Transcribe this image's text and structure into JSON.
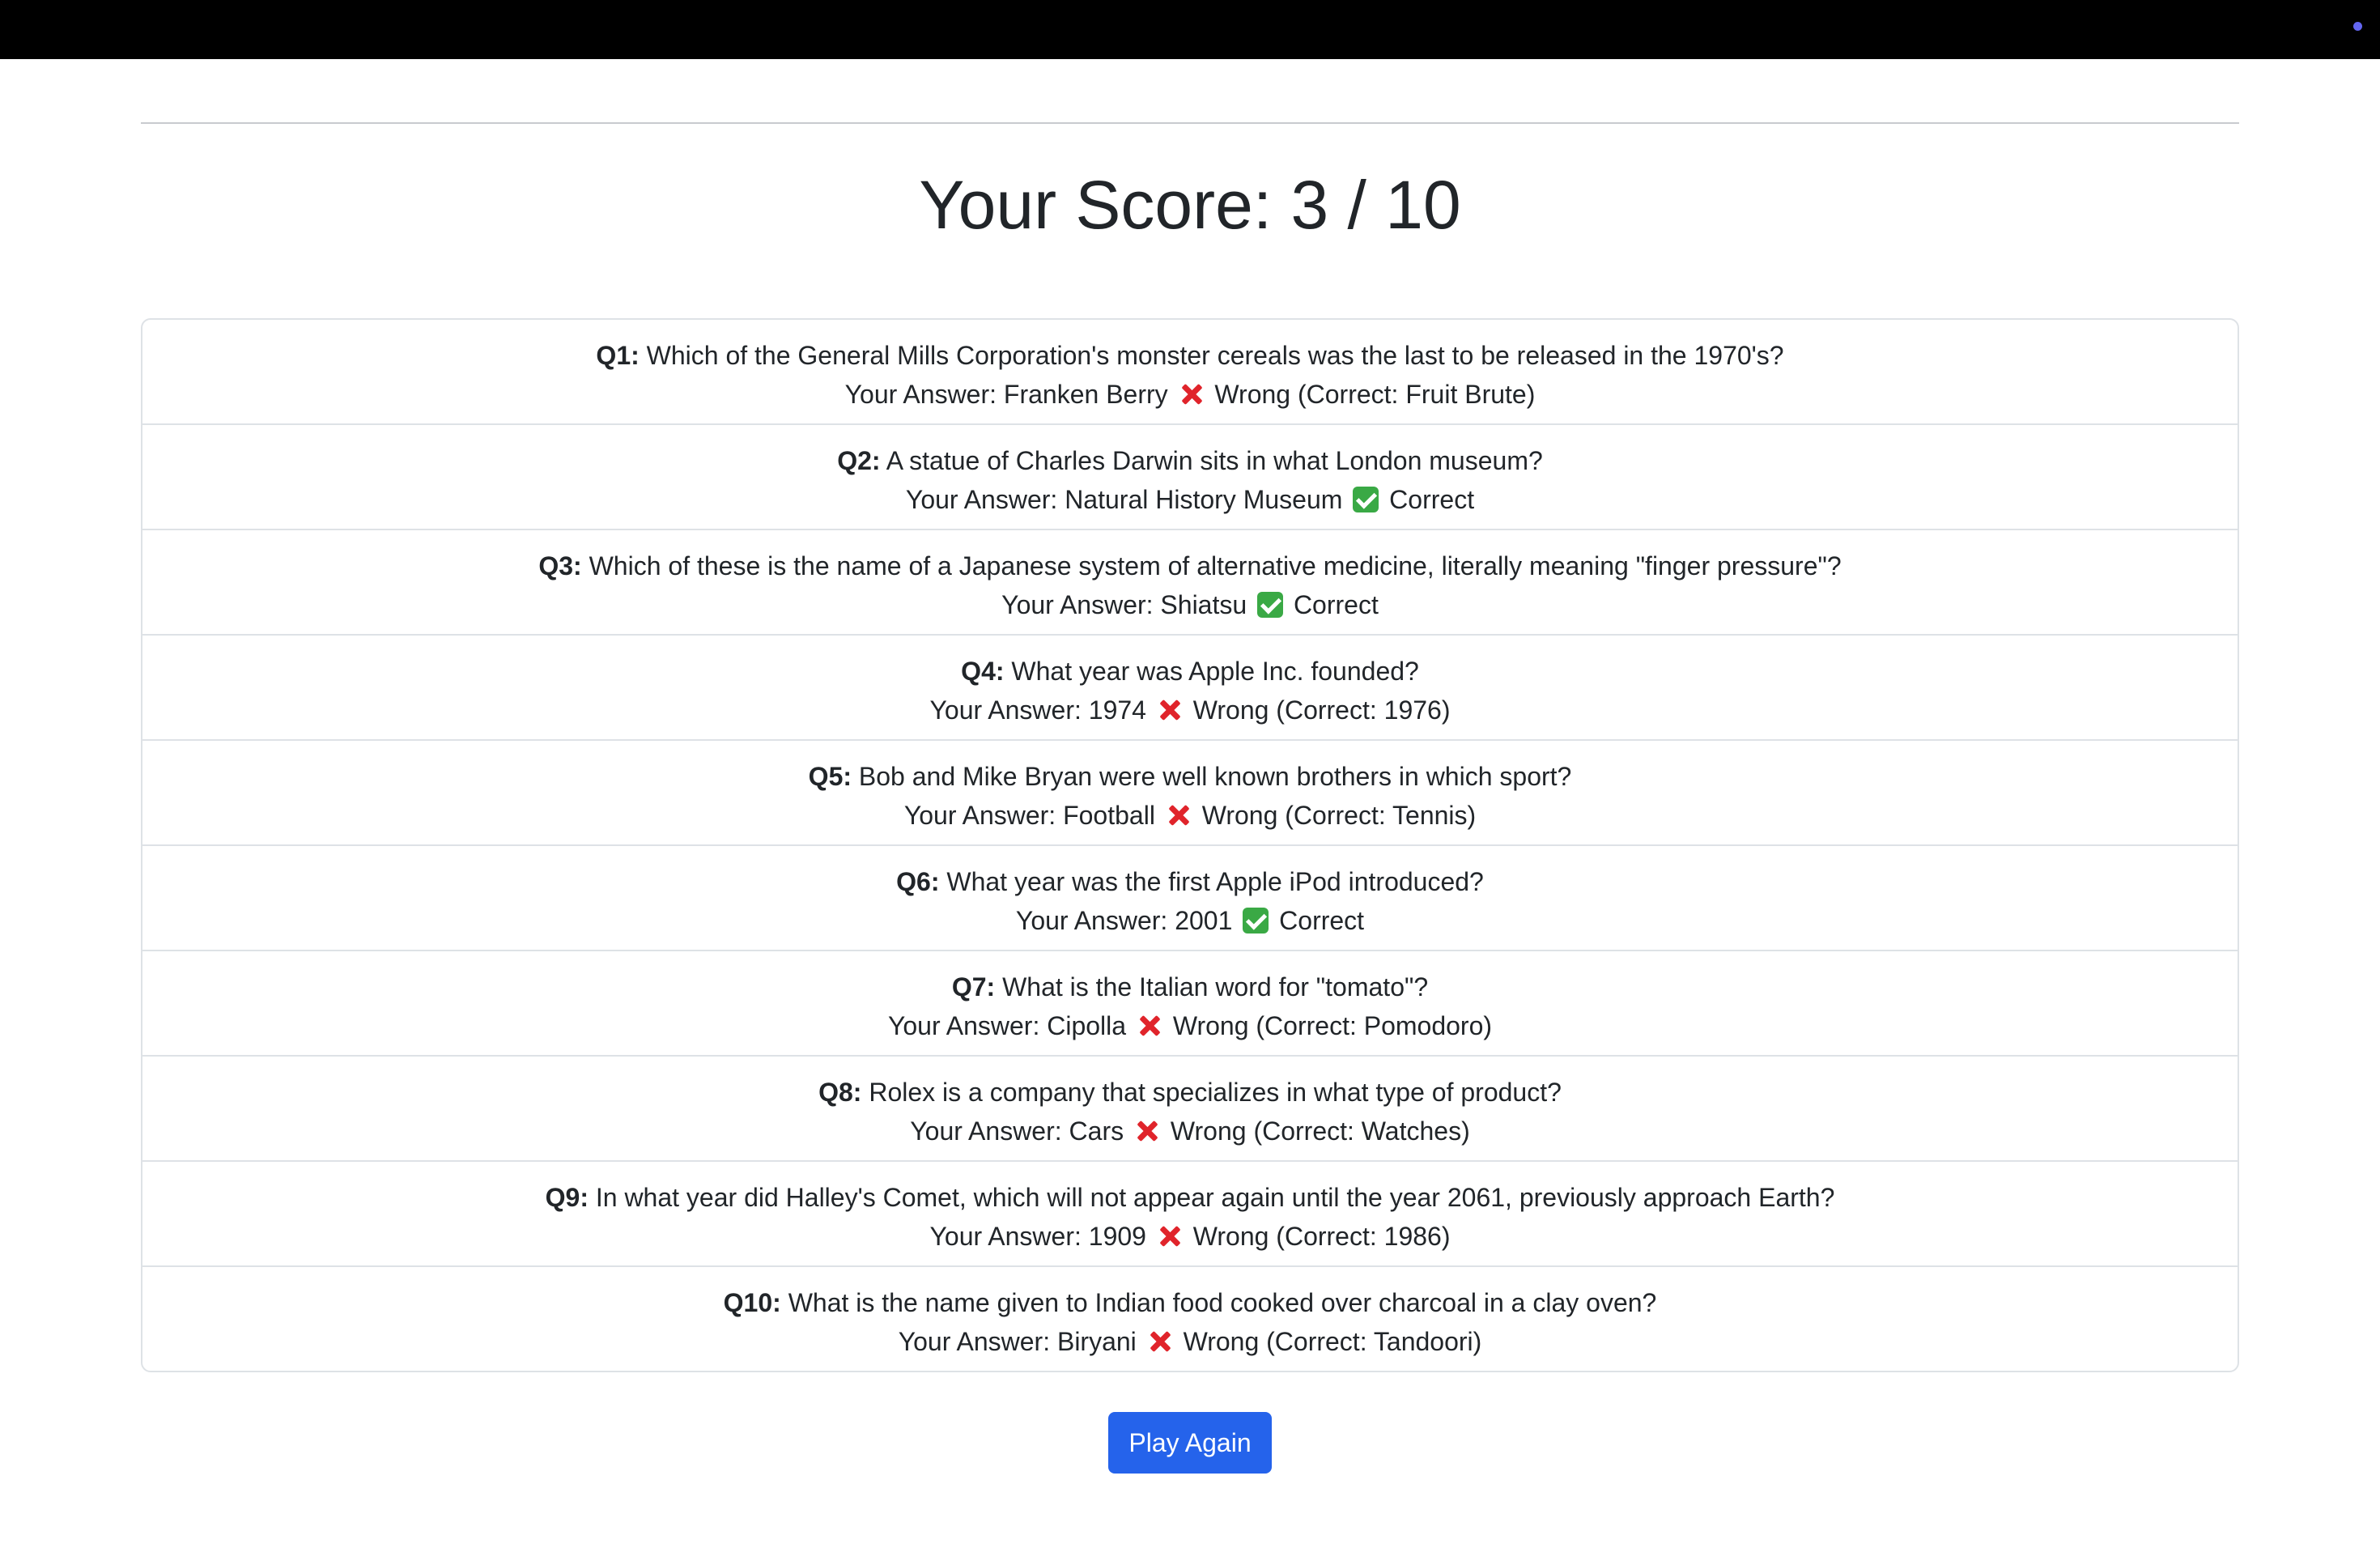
{
  "score": {
    "title": "Your Score: 3 / 10",
    "value": 3,
    "total": 10
  },
  "answer_prefix": "Your Answer: ",
  "results": [
    {
      "label": "Q1:",
      "question": "Which of the General Mills Corporation's monster cereals was the last to be released in the 1970's?",
      "answer": "Franken Berry",
      "status": "wrong",
      "status_text": "Wrong (Correct: Fruit Brute)"
    },
    {
      "label": "Q2:",
      "question": "A statue of Charles Darwin sits in what London museum?",
      "answer": "Natural History Museum",
      "status": "correct",
      "status_text": "Correct"
    },
    {
      "label": "Q3:",
      "question": "Which of these is the name of a Japanese system of alternative medicine, literally meaning \"finger pressure\"?",
      "answer": "Shiatsu",
      "status": "correct",
      "status_text": "Correct"
    },
    {
      "label": "Q4:",
      "question": "What year was Apple Inc. founded?",
      "answer": "1974",
      "status": "wrong",
      "status_text": "Wrong (Correct: 1976)"
    },
    {
      "label": "Q5:",
      "question": "Bob and Mike Bryan were well known brothers in which sport?",
      "answer": "Football",
      "status": "wrong",
      "status_text": "Wrong (Correct: Tennis)"
    },
    {
      "label": "Q6:",
      "question": "What year was the first Apple iPod introduced?",
      "answer": "2001",
      "status": "correct",
      "status_text": "Correct"
    },
    {
      "label": "Q7:",
      "question": "What is the Italian word for \"tomato\"?",
      "answer": "Cipolla",
      "status": "wrong",
      "status_text": "Wrong (Correct: Pomodoro)"
    },
    {
      "label": "Q8:",
      "question": "Rolex is a company that specializes in what type of product?",
      "answer": "Cars",
      "status": "wrong",
      "status_text": "Wrong (Correct: Watches)"
    },
    {
      "label": "Q9:",
      "question": "In what year did Halley's Comet, which will not appear again until the year 2061, previously approach Earth?",
      "answer": "1909",
      "status": "wrong",
      "status_text": "Wrong (Correct: 1986)"
    },
    {
      "label": "Q10:",
      "question": "What is the name given to Indian food cooked over charcoal in a clay oven?",
      "answer": "Biryani",
      "status": "wrong",
      "status_text": "Wrong (Correct: Tandoori)"
    }
  ],
  "icons": {
    "wrong": "cross-mark-icon",
    "correct": "check-mark-icon"
  },
  "play_again_label": "Play Again",
  "colors": {
    "topbar": "#000000",
    "accent_button": "#2563eb",
    "wrong_icon": "#e0242b",
    "correct_icon": "#3aa945"
  }
}
